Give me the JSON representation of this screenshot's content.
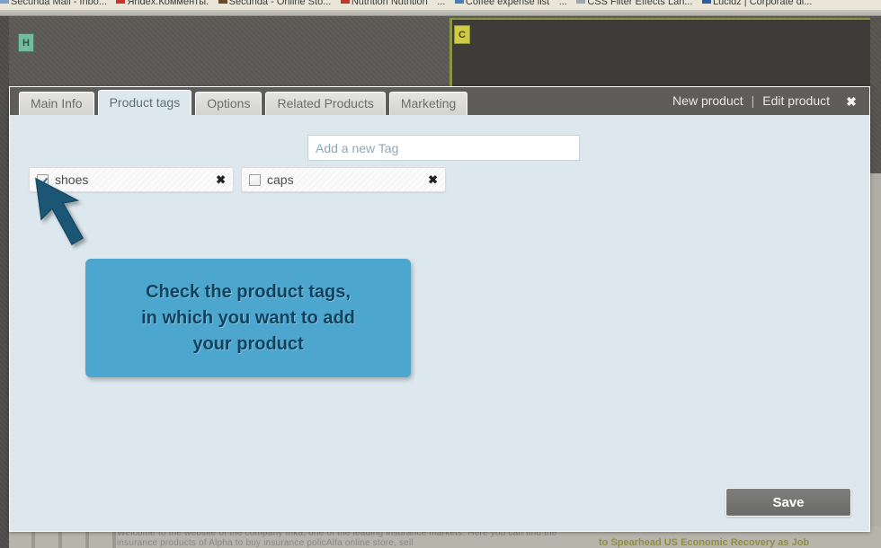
{
  "browser": {
    "bookmarks": [
      {
        "label": "Secunda Mail - Inbo...",
        "icon": "mail-icon"
      },
      {
        "label": "Яndex.Комменты.",
        "icon": "pin-icon"
      },
      {
        "label": "Secunda - Online Sto...",
        "icon": "image-icon"
      },
      {
        "label": "Nutrition Nutrition",
        "icon": "apple-icon"
      },
      {
        "label": "...",
        "icon": "overflow-icon"
      },
      {
        "label": "Coffee expense list",
        "icon": "sheet-icon"
      },
      {
        "label": "...",
        "icon": "overflow-icon"
      },
      {
        "label": "CSS Filter Effects Lan...",
        "icon": "code-icon"
      },
      {
        "label": "Lucidz | Corporate di...",
        "icon": "chart-icon"
      }
    ]
  },
  "background": {
    "badge_h": "H",
    "badge_c": "C",
    "page_text_left": "Welcome to the website of the company Inka, one of the leading insurance markets. Here you can find the insurance products of Alpha to buy insurance policAlfa online store, sell",
    "page_text_right": "to Spearhead US Economic Recovery as Job"
  },
  "modal": {
    "tabs": [
      {
        "label": "Main Info",
        "active": false
      },
      {
        "label": "Product tags",
        "active": true
      },
      {
        "label": "Options",
        "active": false
      },
      {
        "label": "Related Products",
        "active": false
      },
      {
        "label": "Marketing",
        "active": false
      }
    ],
    "titlebar": {
      "new_product_label": "New product",
      "separator": "|",
      "edit_product_label": "Edit product",
      "close_icon": "✖"
    },
    "new_tag": {
      "placeholder": "Add a new Tag",
      "value": ""
    },
    "tags": [
      {
        "label": "shoes",
        "checked": true,
        "delete_icon": "✖"
      },
      {
        "label": "caps",
        "checked": false,
        "delete_icon": "✖"
      }
    ],
    "save_label": "Save"
  },
  "annotation": {
    "callout_text": "Check the product tags, in which you want to add your product",
    "callout_line1": "Check the product tags,",
    "callout_line2": "in which you want to add",
    "callout_line3": "your product",
    "cursor_icon": "arrow-cursor"
  },
  "colors": {
    "modal_body": "#dde8ee",
    "titlebar": "#5e5d59",
    "callout_bg": "#4da6cd",
    "callout_text": "#11435f",
    "save_button": "#6a6a68",
    "badge_h_bg": "#72bda2",
    "badge_c_bg": "#cfcb44",
    "accent_olive": "#8e9445"
  }
}
